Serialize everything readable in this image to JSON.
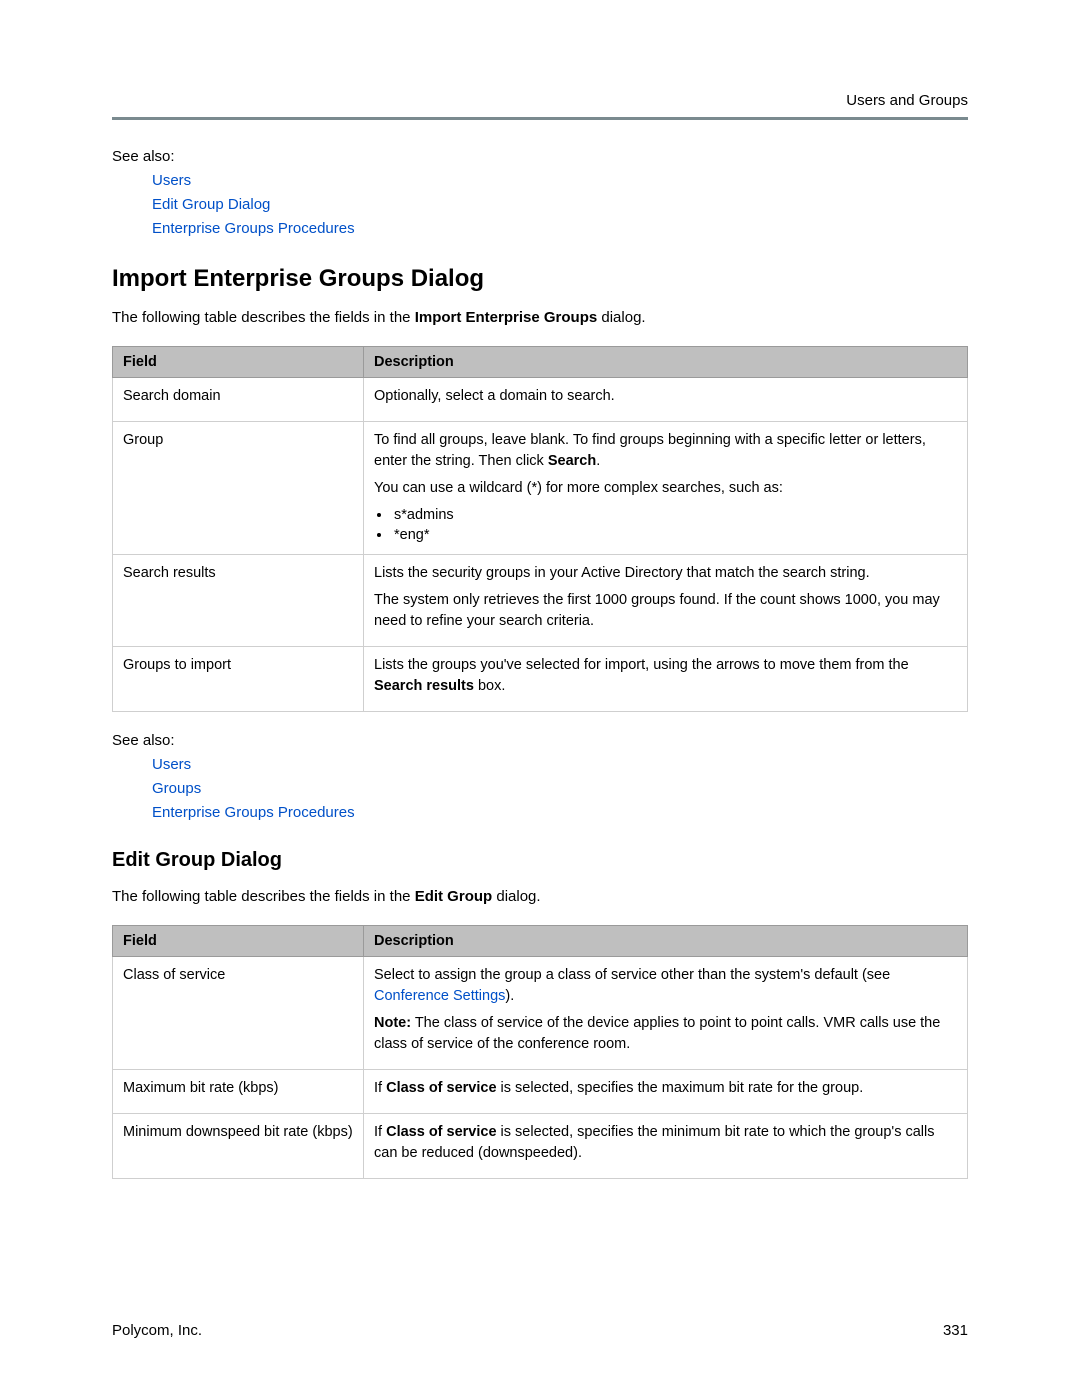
{
  "header": {
    "breadcrumb": "Users and Groups"
  },
  "seeAlso1": {
    "label": "See also:",
    "links": [
      "Users",
      "Edit Group Dialog",
      "Enterprise Groups Procedures"
    ]
  },
  "section1": {
    "heading": "Import Enterprise Groups Dialog",
    "intro_pre": "The following table describes the fields in the ",
    "intro_bold": "Import Enterprise Groups",
    "intro_post": " dialog.",
    "table": {
      "headers": {
        "field": "Field",
        "description": "Description"
      },
      "rows": [
        {
          "field": "Search domain",
          "desc": {
            "p1": "Optionally, select a domain to search."
          }
        },
        {
          "field": "Group",
          "desc": {
            "p1_pre": "To find all groups, leave blank. To find groups beginning with a specific letter or letters, enter the string. Then click ",
            "p1_b": "Search",
            "p1_post": ".",
            "p2": "You can use a wildcard (*) for more complex searches, such as:",
            "bullets": [
              "s*admins",
              "*eng*"
            ]
          }
        },
        {
          "field": "Search results",
          "desc": {
            "p1": "Lists the security groups in your Active Directory that match the search string.",
            "p2": "The system only retrieves the first 1000 groups found. If the count shows 1000, you may need to refine your search criteria."
          }
        },
        {
          "field": "Groups to import",
          "desc": {
            "p1_pre": "Lists the groups you've selected for import, using the arrows to move them from the ",
            "p1_b": "Search results",
            "p1_post": " box."
          }
        }
      ]
    }
  },
  "seeAlso2": {
    "label": "See also:",
    "links": [
      "Users",
      "Groups",
      "Enterprise Groups Procedures"
    ]
  },
  "section2": {
    "heading": "Edit Group Dialog",
    "intro_pre": "The following table describes the fields in the ",
    "intro_bold": "Edit Group",
    "intro_post": " dialog.",
    "table": {
      "headers": {
        "field": "Field",
        "description": "Description"
      },
      "rows": [
        {
          "field": "Class of service",
          "desc": {
            "p1_pre": "Select to assign the group a class of service other than the system's default (see ",
            "p1_link": "Conference Settings",
            "p1_post": ").",
            "p2_b": "Note:",
            "p2_post": " The class of service of the device applies to point to point calls. VMR calls use the class of service of the conference room."
          }
        },
        {
          "field": "Maximum bit rate (kbps)",
          "desc": {
            "p1_pre": "If ",
            "p1_b": "Class of service",
            "p1_post": " is selected, specifies the maximum bit rate for the group."
          }
        },
        {
          "field": "Minimum downspeed bit rate (kbps)",
          "desc": {
            "p1_pre": "If ",
            "p1_b": "Class of service",
            "p1_post": " is selected, specifies the minimum bit rate to which the group's calls can be reduced (downspeeded)."
          }
        }
      ]
    }
  },
  "footer": {
    "company": "Polycom, Inc.",
    "page": "331"
  }
}
